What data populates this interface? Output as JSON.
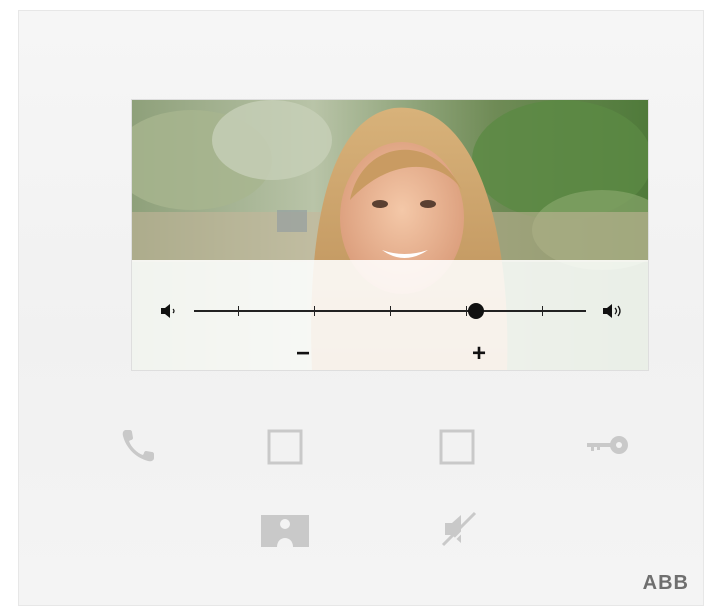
{
  "device": {
    "brand": "ABB"
  },
  "display": {
    "volume": {
      "level_fraction": 0.72,
      "ticks": 5,
      "decrease_label": "−",
      "increase_label": "+"
    }
  },
  "buttons": [
    {
      "id": "call",
      "icon": "phone-icon"
    },
    {
      "id": "function-1",
      "icon": "square-icon"
    },
    {
      "id": "function-2",
      "icon": "square-icon"
    },
    {
      "id": "door-open",
      "icon": "key-icon"
    },
    {
      "id": "caretaker",
      "icon": "person-icon"
    },
    {
      "id": "mute",
      "icon": "speaker-mute-icon"
    }
  ],
  "colors": {
    "panel": "#f3f3f3",
    "icon": "#c9c9c9",
    "brand": "#6f6f6f"
  }
}
